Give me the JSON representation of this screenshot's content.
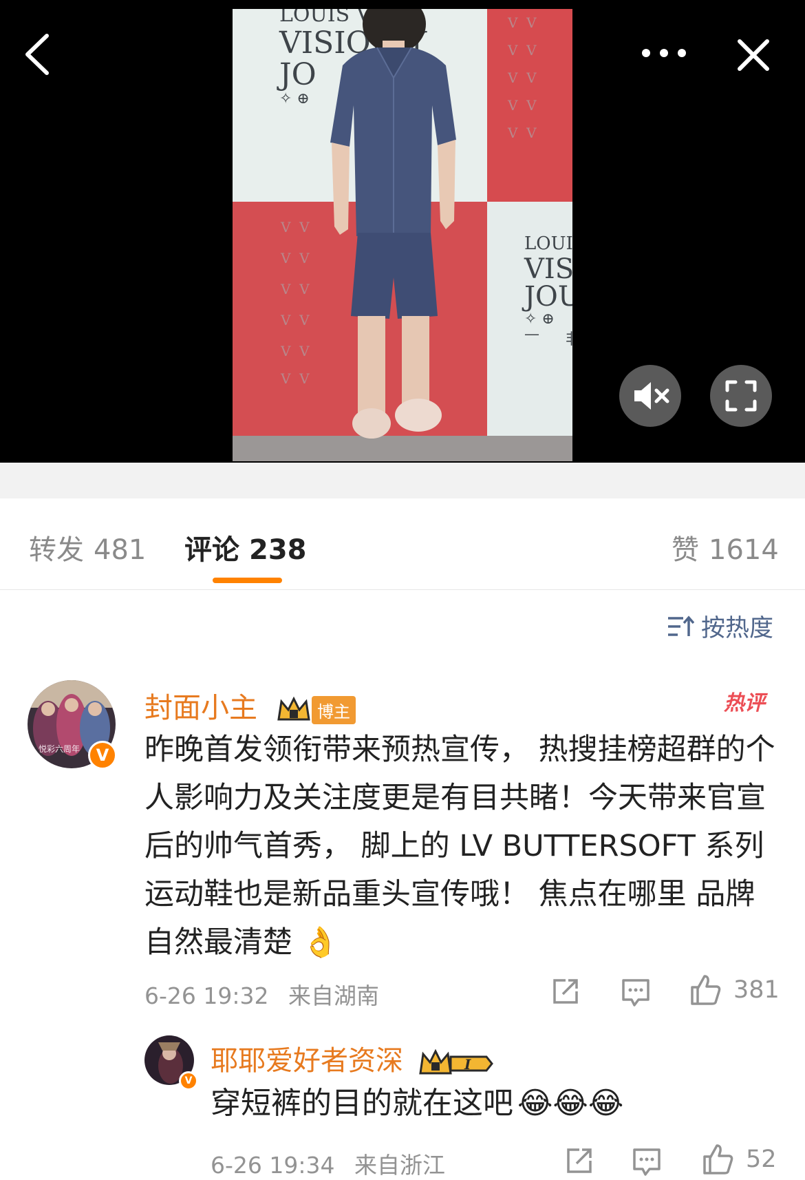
{
  "tabs": {
    "repost_label": "转发",
    "repost_count": "481",
    "comment_label": "评论",
    "comment_count": "238",
    "like_label": "赞",
    "like_count": "1614"
  },
  "sort": {
    "label": "按热度"
  },
  "photo_wall_text": {
    "top_line1": "LOUIS V  ON",
    "top_line2": "VISION  Y",
    "top_line3": "JO",
    "right_line1": "LOUIS",
    "right_line2": "VISI",
    "right_line3": "JOU",
    "right_char": "非"
  },
  "comments": [
    {
      "username": "封面小主",
      "badge": "博主",
      "hot_label": "热评",
      "avatar_text": "悦彩六周年",
      "text": "昨晚首发领衔带来预热宣传， 热搜挂榜超群的个人影响力及关注度更是有目共睹！今天带来官宣后的帅气首秀， 脚上的 LV BUTTERSOFT 系列运动鞋也是新品重头宣传哦！ 焦点在哪里 品牌自然最清楚",
      "emoji": "👌",
      "time": "6-26 19:32",
      "location": "来自湖南",
      "likes": "381"
    },
    {
      "username": "耶耶爱好者资深",
      "level": "I",
      "text": "穿短裤的目的就在这吧",
      "emoji": "😂😂😂",
      "time": "6-26 19:34",
      "location": "来自浙江",
      "likes": "52"
    }
  ],
  "colors": {
    "accent": "#ff8200",
    "username": "#e77a1f",
    "link": "#51678c",
    "hot": "#ec4e55"
  },
  "icons": [
    "back-icon",
    "more-icon",
    "close-icon",
    "mute-icon",
    "fullscreen-icon",
    "sort-icon",
    "share-icon",
    "comment-icon",
    "like-icon"
  ]
}
